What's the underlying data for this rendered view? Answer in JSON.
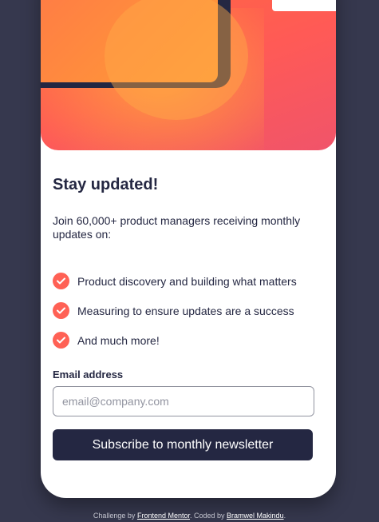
{
  "colors": {
    "page_background": "#36384e",
    "card_background": "#ffffff",
    "primary_dark": "#242742",
    "accent_tomato": "#ff6155",
    "hero_gradient": [
      "#ff6a3d",
      "#ff5a56",
      "#f0546a"
    ]
  },
  "hero": {
    "illustration": "sign-up-illustration"
  },
  "content": {
    "title": "Stay updated!",
    "intro": "Join 60,000+ product managers receiving monthly updates on:",
    "features": [
      {
        "icon": "check-icon",
        "text": "Product discovery and building what matters"
      },
      {
        "icon": "check-icon",
        "text": "Measuring to ensure updates are a success"
      },
      {
        "icon": "check-icon",
        "text": "And much more!"
      }
    ]
  },
  "form": {
    "email_label": "Email address",
    "email_value": "",
    "email_placeholder": "email@company.com",
    "submit_label": "Subscribe to monthly newsletter"
  },
  "attribution": {
    "challenge_prefix": "Challenge by",
    "challenge_link": "Frontend Mentor",
    "coded_prefix": ". Coded by",
    "coded_link": "Bramwel Makindu",
    "suffix": "."
  }
}
